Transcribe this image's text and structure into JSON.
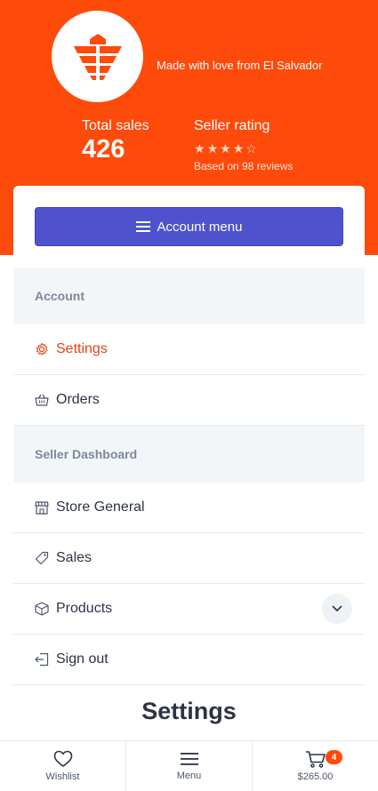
{
  "store": {
    "tagline": "Made with love from El Salvador",
    "total_sales_label": "Total sales",
    "total_sales_value": "426",
    "rating_label": "Seller rating",
    "rating_value": 4,
    "rating_max": 5,
    "reviews_text": "Based on 98 reviews",
    "logo_icon": "ship-icon"
  },
  "account_menu": {
    "button_label": "Account menu",
    "sections": [
      {
        "title": "Account",
        "items": [
          {
            "label": "Settings",
            "icon": "gear-icon",
            "active": true
          },
          {
            "label": "Orders",
            "icon": "basket-icon",
            "active": false
          }
        ]
      },
      {
        "title": "Seller Dashboard",
        "items": [
          {
            "label": "Store General",
            "icon": "store-icon"
          },
          {
            "label": "Sales",
            "icon": "tag-icon"
          },
          {
            "label": "Products",
            "icon": "box-icon",
            "expandable": true
          },
          {
            "label": "Sign out",
            "icon": "sign-out-icon"
          }
        ]
      }
    ]
  },
  "page": {
    "title": "Settings"
  },
  "bottom_nav": {
    "wishlist_label": "Wishlist",
    "menu_label": "Menu",
    "cart_count": "4",
    "cart_total": "$265.00"
  },
  "colors": {
    "brand": "#fe4a0a",
    "accent": "#4e53cd",
    "active_text": "#e94314"
  }
}
